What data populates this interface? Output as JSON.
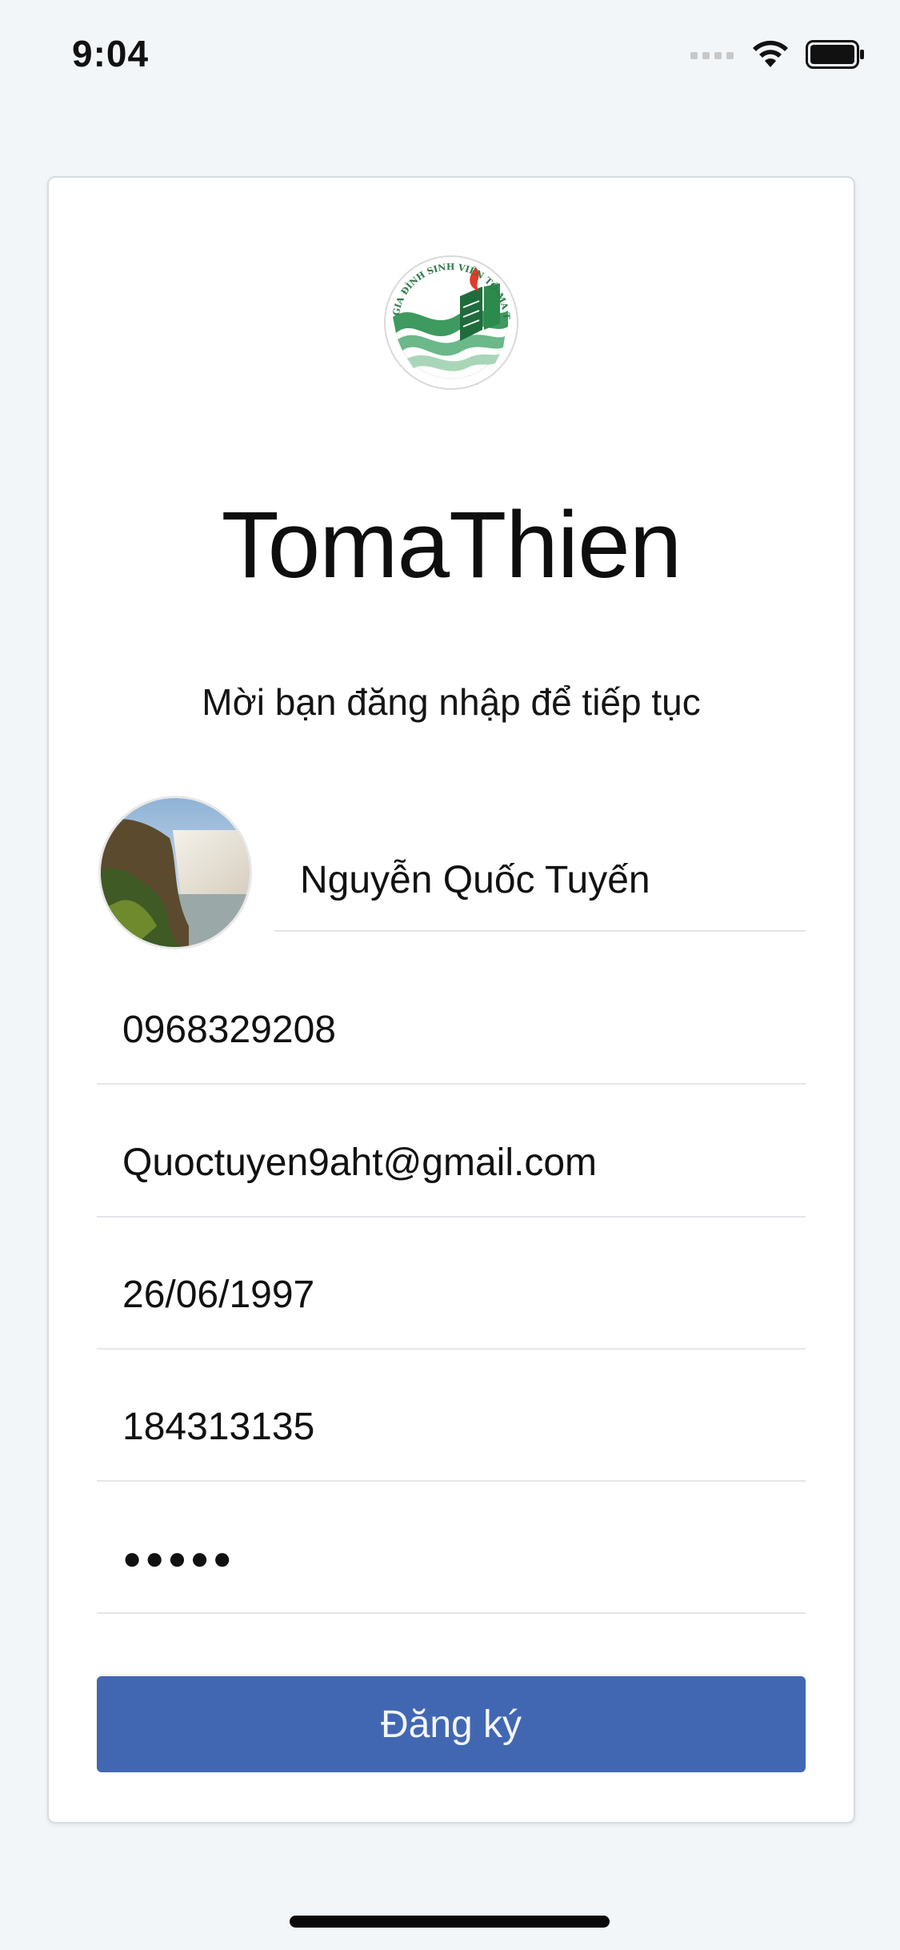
{
  "status_bar": {
    "time": "9:04",
    "icons": [
      "cellular-signal-icon",
      "wifi-icon",
      "battery-icon"
    ]
  },
  "logo": {
    "icon": "tomathien-logo",
    "ring_text": "GIA ĐÌNH SINH VIÊN TÔ-MA THIỆN"
  },
  "header": {
    "title": "TomaThien",
    "subtitle": "Mời bạn đăng nhập để tiếp tục"
  },
  "form": {
    "avatar_icon": "user-avatar-photo",
    "name": "Nguyễn Quốc Tuyến",
    "phone": "0968329208",
    "email": "Quoctuyen9aht@gmail.com",
    "birthdate": "26/06/1997",
    "id_number": "184313135",
    "password_masked": "●●●●●"
  },
  "actions": {
    "register_label": "Đăng ký"
  },
  "colors": {
    "background": "#f3f6f9",
    "button": "#4267b2",
    "logo_green": "#2e9a5a",
    "logo_red": "#e23b2c"
  }
}
